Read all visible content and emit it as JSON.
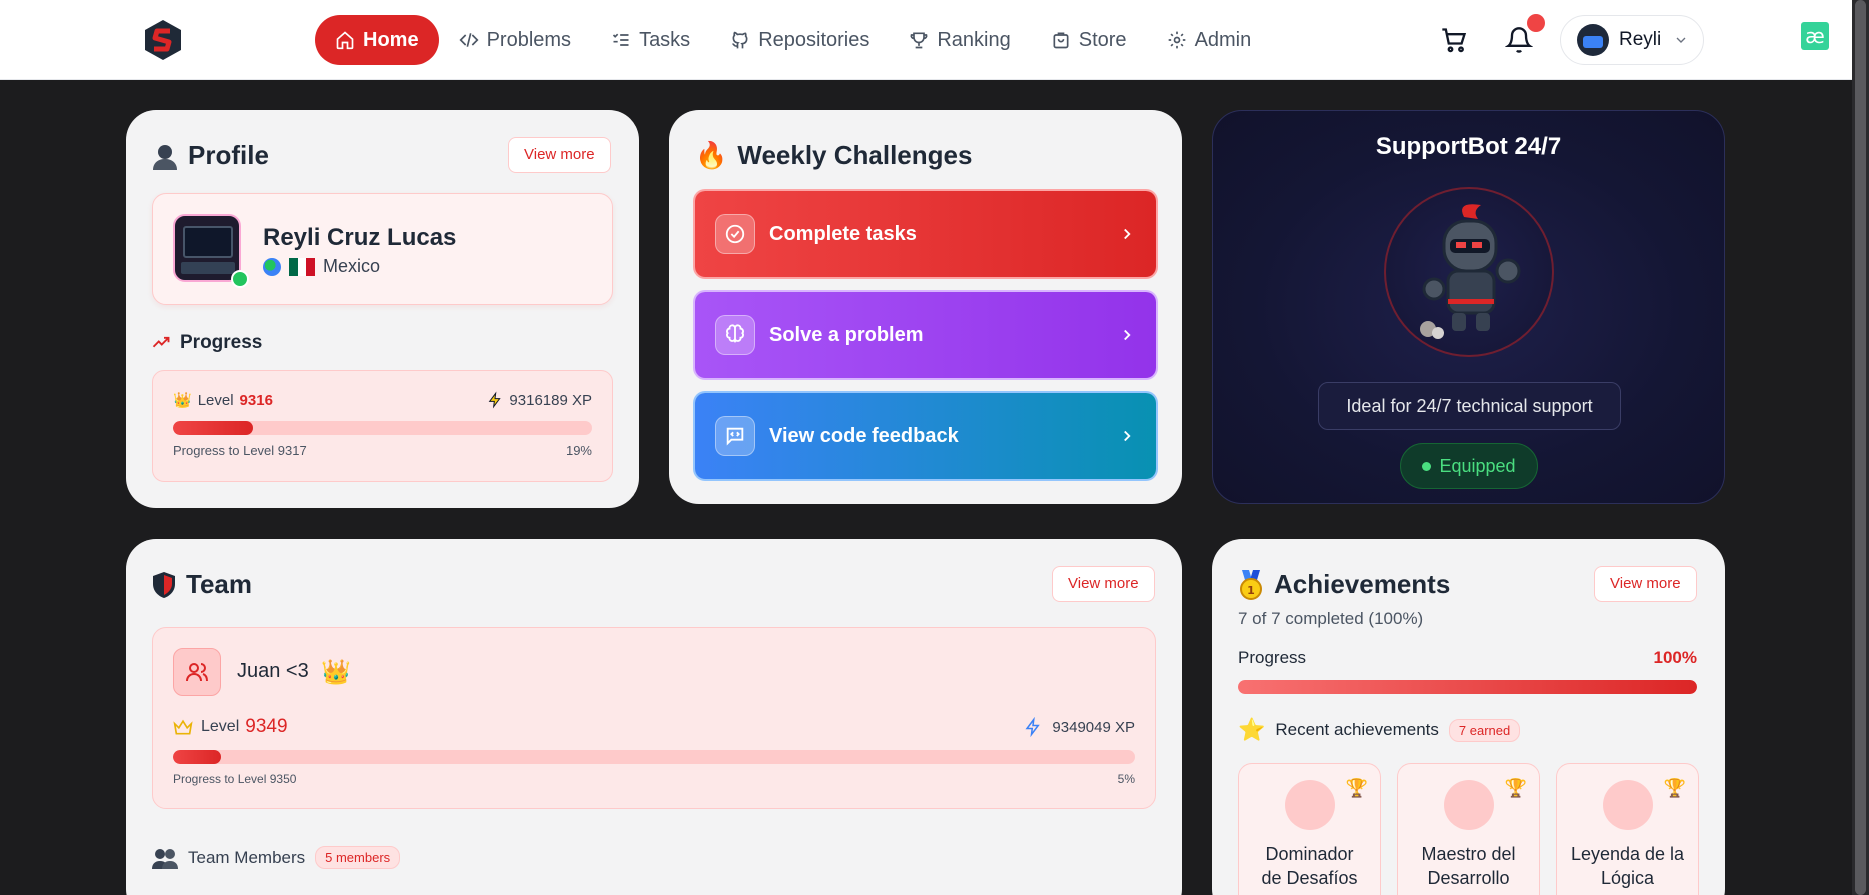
{
  "nav": {
    "items": [
      {
        "label": "Home",
        "icon": "home-icon",
        "active": true
      },
      {
        "label": "Problems",
        "icon": "code-icon",
        "active": false
      },
      {
        "label": "Tasks",
        "icon": "list-icon",
        "active": false
      },
      {
        "label": "Repositories",
        "icon": "github-icon",
        "active": false
      },
      {
        "label": "Ranking",
        "icon": "trophy-icon",
        "active": false
      },
      {
        "label": "Store",
        "icon": "store-icon",
        "active": false
      },
      {
        "label": "Admin",
        "icon": "gear-icon",
        "active": false
      }
    ],
    "user_name": "Reyli",
    "extension_glyph": "æ"
  },
  "profile": {
    "title": "Profile",
    "view_more": "View more",
    "name": "Reyli Cruz Lucas",
    "country": "Mexico",
    "progress_title": "Progress",
    "level_label": "Level",
    "level": "9316",
    "xp": "9316189 XP",
    "next_level_text": "Progress to Level 9317",
    "percent_text": "19%",
    "percent": 19
  },
  "weekly": {
    "title": "Weekly Challenges",
    "challenges": [
      {
        "label": "Complete tasks",
        "icon": "check-circle-icon"
      },
      {
        "label": "Solve a problem",
        "icon": "brain-icon"
      },
      {
        "label": "View code feedback",
        "icon": "message-code-icon"
      }
    ]
  },
  "bot": {
    "title": "SupportBot 24/7",
    "description": "Ideal for 24/7 technical support",
    "status": "Equipped"
  },
  "team": {
    "title": "Team",
    "view_more": "View more",
    "name": "Juan <3",
    "level_label": "Level",
    "level": "9349",
    "xp": "9349049 XP",
    "next_level_text": "Progress to Level 9350",
    "percent_text": "5%",
    "percent": 5,
    "members_title": "Team Members",
    "members_badge": "5 members"
  },
  "achievements": {
    "title": "Achievements",
    "view_more": "View more",
    "subtitle": "7 of 7 completed (100%)",
    "progress_label": "Progress",
    "progress_text": "100%",
    "percent": 100,
    "recent_label": "Recent achievements",
    "recent_badge": "7 earned",
    "items": [
      {
        "line1": "Dominador",
        "line2": "de Desafíos"
      },
      {
        "line1": "Maestro del",
        "line2": "Desarrollo"
      },
      {
        "line1": "Leyenda de la",
        "line2": "Lógica"
      }
    ]
  },
  "colors": {
    "accent": "#dc2626",
    "purple": "#9333ea",
    "blue": "#3b82f6",
    "success": "#4ade80"
  }
}
